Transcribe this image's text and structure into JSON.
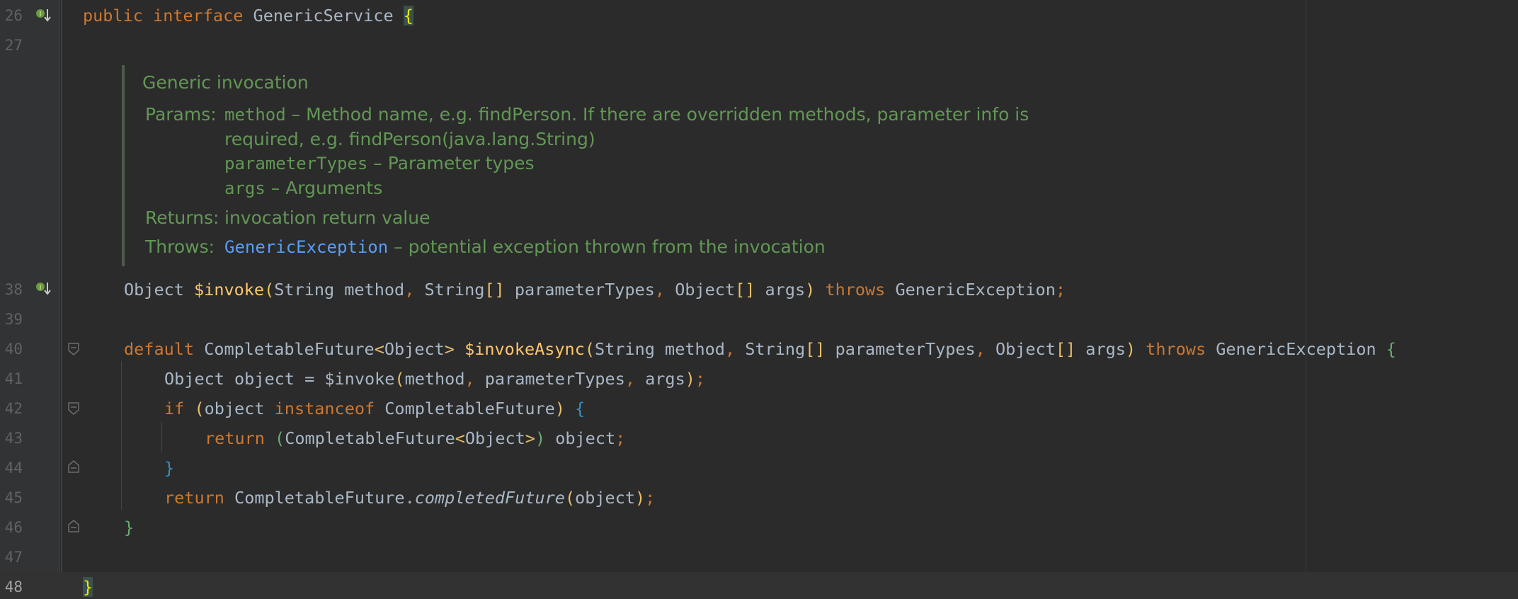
{
  "editor": {
    "gutter": {
      "line_numbers": [
        "26",
        "27",
        "38",
        "39",
        "40",
        "41",
        "42",
        "43",
        "44",
        "45",
        "46",
        "47",
        "48"
      ],
      "current_line": "48"
    },
    "header_line": {
      "kw_public": "public",
      "kw_interface": "interface",
      "name": "GenericService",
      "open_brace": "{"
    },
    "javadoc": {
      "summary": "Generic invocation",
      "params_label": "Params:",
      "param1_name": "method",
      "param1_desc": " – Method name, e.g. findPerson. If there are overridden methods, parameter info is",
      "param1_desc_cont": "required, e.g. findPerson(java.lang.String)",
      "param2_name": "parameterTypes",
      "param2_desc": " – Parameter types",
      "param3_name": "args",
      "param3_desc": " – Arguments",
      "returns_label": "Returns:",
      "returns_desc": "invocation return value",
      "throws_label": "Throws:",
      "throws_type": "GenericException",
      "throws_desc": " – potential exception thrown from the invocation"
    },
    "line38": {
      "t1": "Object ",
      "fn": "$invoke",
      "p1": "(",
      "t2": "String method",
      "c1": ", ",
      "t3": "String",
      "arr1": "[]",
      "t4": " parameterTypes",
      "c2": ", ",
      "t5": "Object",
      "arr2": "[]",
      "t6": " args",
      "p2": ")",
      "kw_throws": " throws ",
      "t7": "GenericException",
      "semi": ";"
    },
    "line40": {
      "kw_default": "default ",
      "t1": "CompletableFuture",
      "lt": "<",
      "t2": "Object",
      "gt": ">",
      "sp": " ",
      "fn": "$invokeAsync",
      "p1": "(",
      "t3": "String method",
      "c1": ", ",
      "t4": "String",
      "arr1": "[]",
      "t5": " parameterTypes",
      "c2": ", ",
      "t6": "Object",
      "arr2": "[]",
      "t7": " args",
      "p2": ")",
      "kw_throws": " throws ",
      "t8": "GenericException ",
      "brace": "{"
    },
    "line41": {
      "t1": "Object object = $invoke",
      "p1": "(",
      "t2": "method",
      "c1": ", ",
      "t3": "parameterTypes",
      "c2": ", ",
      "t4": "args",
      "p2": ")",
      "semi": ";"
    },
    "line42": {
      "kw_if": "if ",
      "p1": "(",
      "t1": "object ",
      "kw_instanceof": "instanceof",
      "t2": " CompletableFuture",
      "p2": ")",
      "sp": " ",
      "brace": "{"
    },
    "line43": {
      "kw_return": "return ",
      "p1": "(",
      "t1": "CompletableFuture",
      "lt": "<",
      "t2": "Object",
      "gt": ">",
      "p2": ")",
      "t3": " object",
      "semi": ";"
    },
    "line44": {
      "brace": "}"
    },
    "line45": {
      "kw_return": "return ",
      "t1": "CompletableFuture.",
      "it": "completedFuture",
      "p1": "(",
      "t2": "object",
      "p2": ")",
      "semi": ";"
    },
    "line46": {
      "brace": "}"
    },
    "line48": {
      "brace": "}"
    },
    "icons": {
      "implemented": "implemented-marker-icon",
      "fold": "fold-marker-icon"
    },
    "colors": {
      "background": "#2b2b2b",
      "gutter": "#313335",
      "keyword": "#cc7832",
      "method_decl": "#ffc66d",
      "plain": "#a9b7c6",
      "doc_comment": "#629755",
      "doc_link": "#589df6",
      "line_number": "#606366"
    }
  }
}
